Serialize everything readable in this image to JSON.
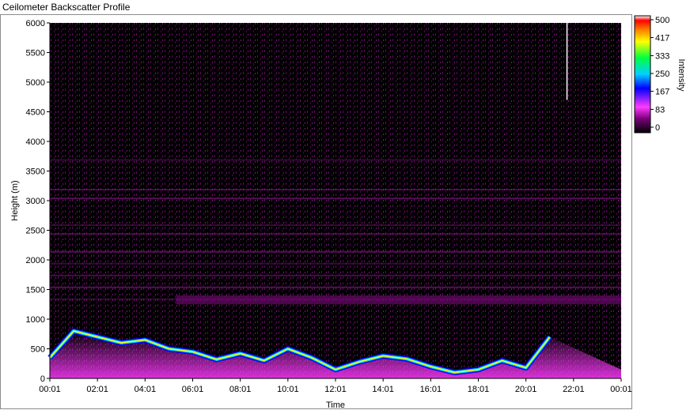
{
  "window": {
    "title": "Ceilometer Backscatter Profile"
  },
  "chart_data": {
    "type": "heatmap",
    "title": "",
    "xlabel": "Time",
    "ylabel": "Height (m)",
    "x_ticks": [
      "00:01",
      "02:01",
      "04:01",
      "06:01",
      "08:01",
      "10:01",
      "12:01",
      "14:01",
      "16:01",
      "18:01",
      "20:01",
      "22:01",
      "00:01"
    ],
    "y_ticks": [
      0,
      500,
      1000,
      1500,
      2000,
      2500,
      3000,
      3500,
      4000,
      4500,
      5000,
      5500,
      6000
    ],
    "ylim": [
      0,
      6000
    ],
    "colorbar": {
      "label": "Intensity",
      "range": [
        0,
        500
      ],
      "ticks": [
        500,
        417,
        333,
        250,
        167,
        83,
        0
      ],
      "colors": [
        "#000000",
        "#c100c1",
        "#ff3aff",
        "#0000ff",
        "#00d0ff",
        "#00ff40",
        "#ffff00",
        "#ff7f00",
        "#ff0000",
        "#ffffff"
      ]
    },
    "cloud_layer": {
      "description_units": "height (m) at each hour",
      "hours": [
        0,
        1,
        2,
        3,
        4,
        5,
        6,
        7,
        8,
        9,
        10,
        11,
        12,
        13,
        14,
        15,
        16,
        17,
        18,
        19,
        20,
        21
      ],
      "height": [
        350,
        800,
        700,
        600,
        650,
        500,
        450,
        320,
        420,
        300,
        500,
        350,
        150,
        280,
        380,
        330,
        200,
        100,
        150,
        300,
        180,
        700
      ]
    },
    "background_noise_level": 83,
    "grid": false,
    "legend": "right"
  }
}
